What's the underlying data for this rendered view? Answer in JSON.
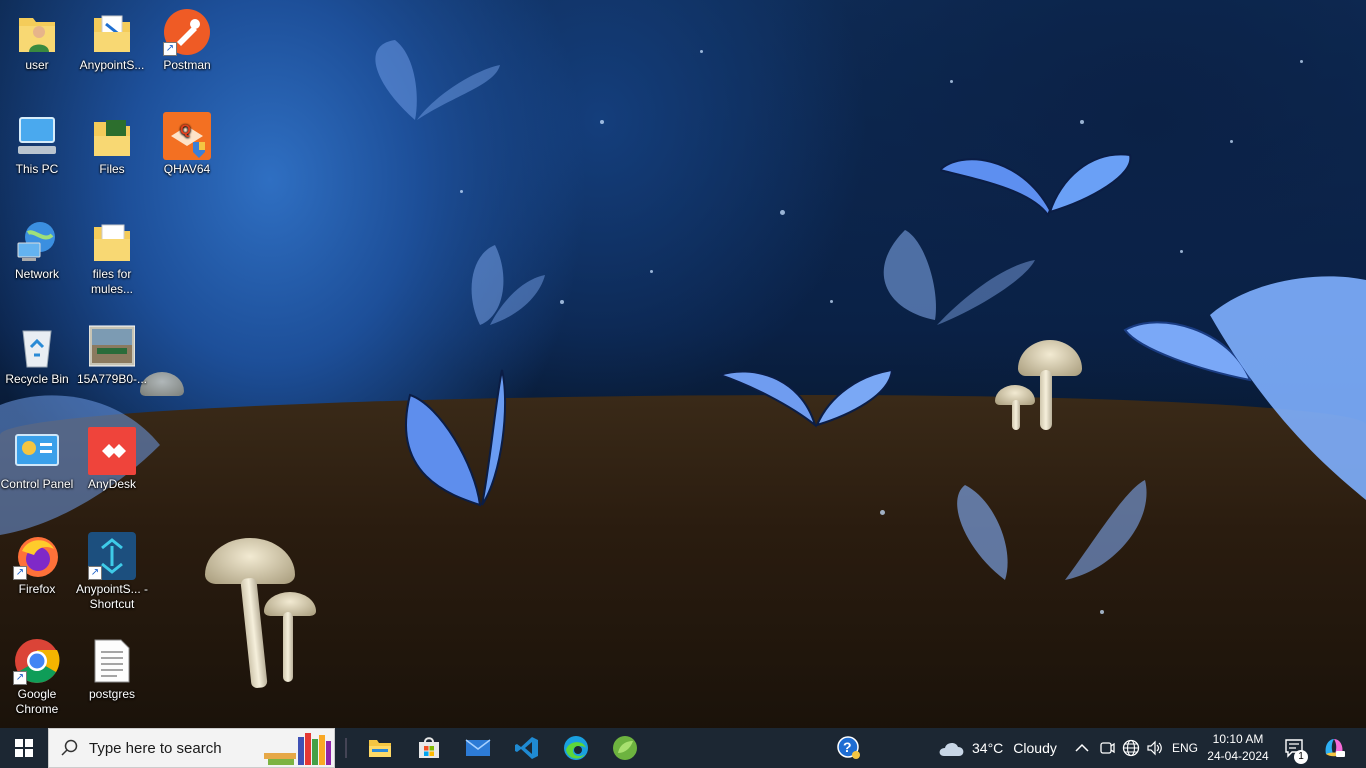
{
  "desktop": {
    "icons": [
      {
        "label": "user",
        "icon": "user-folder-icon"
      },
      {
        "label": "AnypointS...",
        "icon": "anypoint-folder-icon"
      },
      {
        "label": "Postman",
        "icon": "postman-icon"
      },
      {
        "label": "This PC",
        "icon": "this-pc-icon"
      },
      {
        "label": "Files",
        "icon": "files-folder-icon"
      },
      {
        "label": "QHAV64",
        "icon": "qhav64-icon"
      },
      {
        "label": "Network",
        "icon": "network-icon"
      },
      {
        "label": "files for mules...",
        "icon": "folder-icon"
      },
      {
        "label": "Recycle Bin",
        "icon": "recycle-bin-icon"
      },
      {
        "label": "15A779B0-...",
        "icon": "image-file-icon"
      },
      {
        "label": "Control Panel",
        "icon": "control-panel-icon"
      },
      {
        "label": "AnyDesk",
        "icon": "anydesk-icon"
      },
      {
        "label": "Firefox",
        "icon": "firefox-icon"
      },
      {
        "label": "AnypointS... - Shortcut",
        "icon": "anypoint-studio-icon"
      },
      {
        "label": "Google Chrome",
        "icon": "chrome-icon"
      },
      {
        "label": "postgres",
        "icon": "text-file-icon"
      }
    ]
  },
  "taskbar": {
    "search_placeholder": "Type here to search",
    "apps": [
      "file-explorer-icon",
      "microsoft-store-icon",
      "mail-icon",
      "vscode-icon",
      "edge-icon",
      "spring-tools-icon"
    ],
    "weather": {
      "temp": "34°C",
      "condition": "Cloudy"
    },
    "language": "ENG",
    "time": "10:10 AM",
    "date": "24-04-2024",
    "notification_count": "1"
  },
  "colors": {
    "taskbar_bg": "#1c2733",
    "search_bg": "#f3f3f3",
    "accent": "#3a8ee6"
  }
}
